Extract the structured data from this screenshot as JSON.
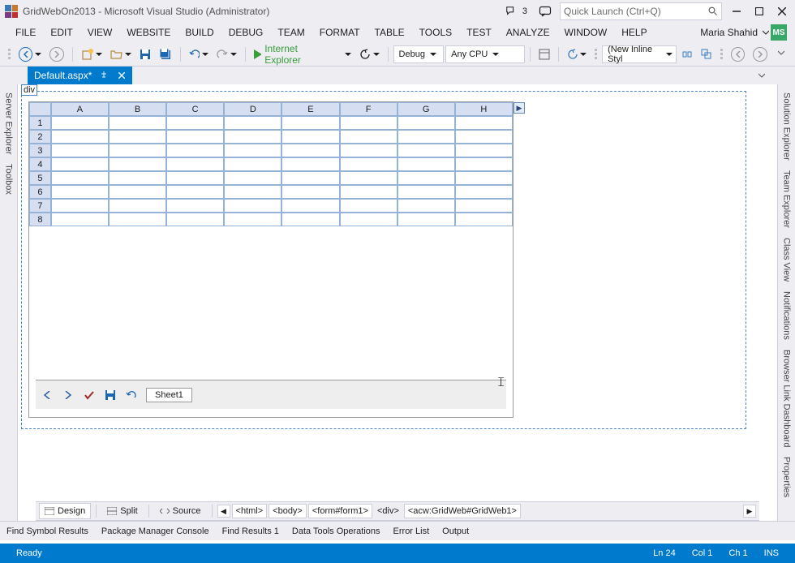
{
  "window": {
    "title": "GridWebOn2013 - Microsoft Visual Studio (Administrator)",
    "notifications_count": "3",
    "quick_launch_placeholder": "Quick Launch (Ctrl+Q)"
  },
  "menu": {
    "items": [
      "FILE",
      "EDIT",
      "VIEW",
      "WEBSITE",
      "BUILD",
      "DEBUG",
      "TEAM",
      "FORMAT",
      "TABLE",
      "TOOLS",
      "TEST",
      "ANALYZE",
      "WINDOW",
      "HELP"
    ],
    "user_name": "Maria Shahid",
    "user_initials": "MS"
  },
  "toolbar": {
    "browser": "Internet Explorer",
    "config": "Debug",
    "platform": "Any CPU",
    "style": "(New Inline Styl"
  },
  "tabs": {
    "active": "Default.aspx*"
  },
  "sidebars": {
    "left": [
      "Server Explorer",
      "Toolbox"
    ],
    "right": [
      "Solution Explorer",
      "Team Explorer",
      "Class View",
      "Notifications",
      "Browser Link Dashboard",
      "Properties"
    ]
  },
  "designer": {
    "tag_label": "div",
    "sheet_name": "Sheet1",
    "columns": [
      "A",
      "B",
      "C",
      "D",
      "E",
      "F",
      "G",
      "H"
    ],
    "rows": [
      "1",
      "2",
      "3",
      "4",
      "5",
      "6",
      "7",
      "8"
    ]
  },
  "designer_tabs": {
    "design": "Design",
    "split": "Split",
    "source": "Source",
    "path": [
      "<html>",
      "<body>",
      "<form#form1>",
      "<div>",
      "<acw:GridWeb#GridWeb1>"
    ]
  },
  "output_tabs": [
    "Find Symbol Results",
    "Package Manager Console",
    "Find Results 1",
    "Data Tools Operations",
    "Error List",
    "Output"
  ],
  "status": {
    "ready": "Ready",
    "line": "Ln 24",
    "col": "Col 1",
    "ch": "Ch 1",
    "ins": "INS"
  }
}
